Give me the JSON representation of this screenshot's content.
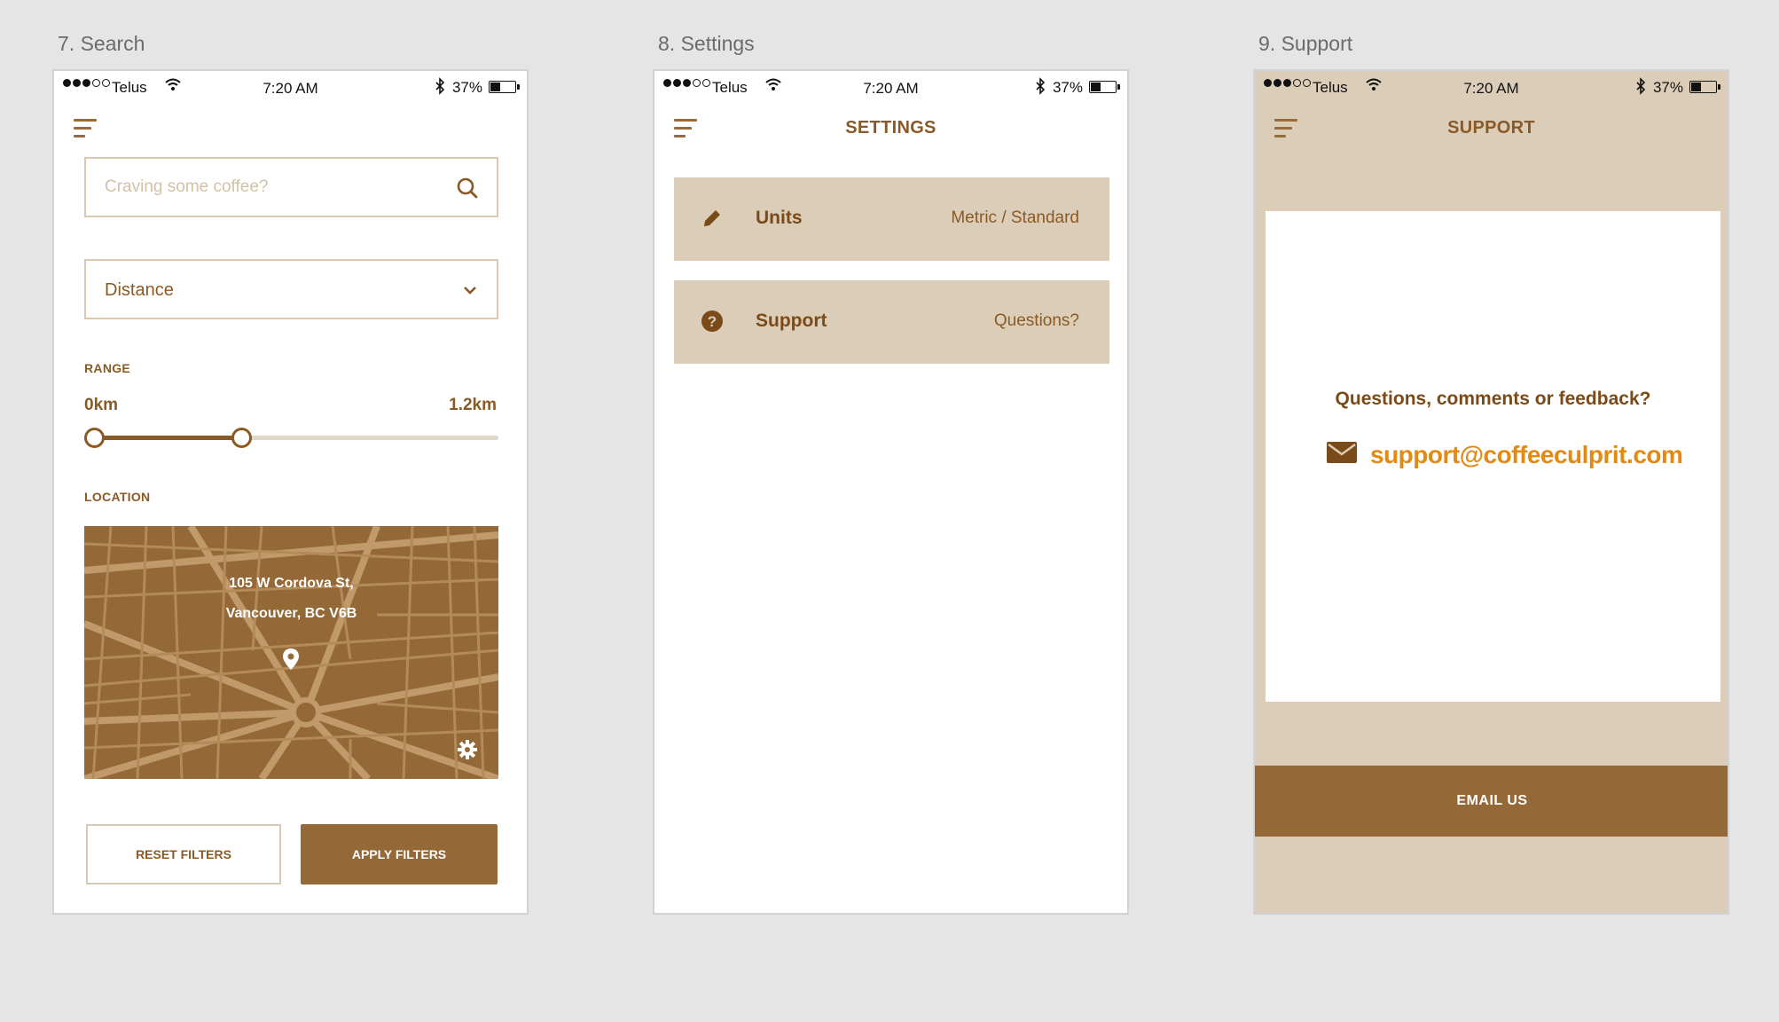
{
  "artboards": [
    {
      "label": "7. Search"
    },
    {
      "label": "8. Settings"
    },
    {
      "label": "9. Support"
    }
  ],
  "status_bar": {
    "carrier": "Telus",
    "time": "7:20 AM",
    "battery": "37%"
  },
  "colors": {
    "brand_brown": "#956937",
    "dark_brown": "#7a4a18",
    "tan": "#dccdb9",
    "accent_orange": "#e28a14"
  },
  "search_screen": {
    "search_placeholder": "Craving some coffee?",
    "sort_selected": "Distance",
    "range_label": "RANGE",
    "range_min": "0km",
    "range_max": "1.2km",
    "range_fraction": 0.36,
    "location_label": "LOCATION",
    "address_line1": "105 W Cordova St,",
    "address_line2": "Vancouver, BC V6B",
    "reset_button": "RESET FILTERS",
    "apply_button": "APPLY FILTERS"
  },
  "settings_screen": {
    "title": "SETTINGS",
    "rows": [
      {
        "label": "Units",
        "value": "Metric / Standard",
        "icon": "pencil-icon"
      },
      {
        "label": "Support",
        "value": "Questions?",
        "icon": "question-circle-icon"
      }
    ]
  },
  "support_screen": {
    "title": "SUPPORT",
    "question": "Questions, comments or feedback?",
    "email": "support@coffeeculprit.com",
    "email_button": "EMAIL US"
  }
}
